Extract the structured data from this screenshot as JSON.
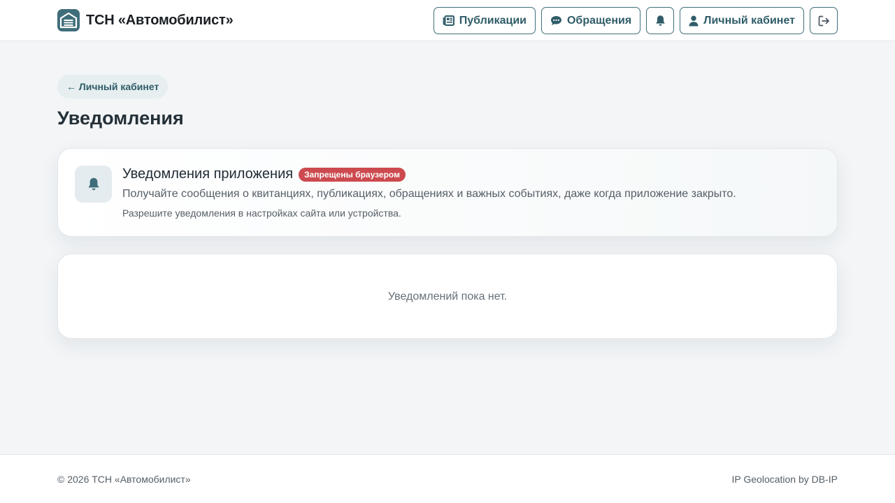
{
  "header": {
    "brand_name": "ТСН «Автомобилист»",
    "nav": {
      "publications": "Публикации",
      "appeals": "Обращения",
      "cabinet": "Личный кабинет"
    }
  },
  "back_link": "← Личный кабинет",
  "page_title": "Уведомления",
  "app_notifications": {
    "title": "Уведомления приложения",
    "badge": "Запрещены браузером",
    "description": "Получайте сообщения о квитанциях, публикациях, обращениях и важных событиях, даже когда приложение закрыто.",
    "hint": "Разрешите уведомления в настройках сайта или устройства."
  },
  "empty_state": "Уведомлений пока нет.",
  "footer": {
    "copyright": "© 2026 ТСН «Автомобилист»",
    "credit": "IP Geolocation by DB-IP"
  },
  "colors": {
    "accent": "#3f6e7a",
    "badge_danger": "#cc4a4f",
    "background": "#f3f5f7"
  },
  "icons": [
    "garage-logo-icon",
    "newspaper-icon",
    "comment-icon",
    "bell-icon",
    "user-icon",
    "logout-icon"
  ]
}
